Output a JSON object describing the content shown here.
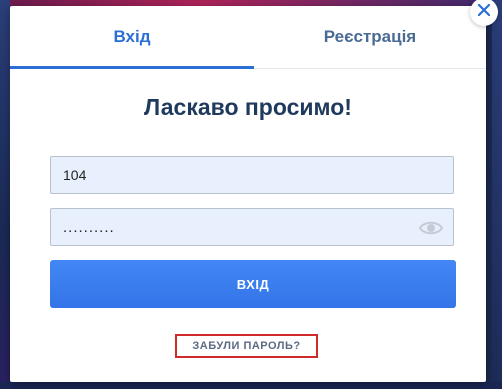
{
  "tabs": {
    "login_label": "Вхід",
    "register_label": "Реєстрація"
  },
  "modal": {
    "title": "Ласкаво просимо!"
  },
  "form": {
    "login_value": "104",
    "password_value": "..........",
    "submit_label": "ВХІД",
    "forgot_label": "ЗАБУЛИ ПАРОЛЬ?"
  },
  "icons": {
    "close": "close-icon",
    "eye": "eye-icon"
  },
  "colors": {
    "accent": "#2a6fd6",
    "button": "#3a7df2",
    "highlight_border": "#d12a2a",
    "title": "#1f3a5c"
  }
}
